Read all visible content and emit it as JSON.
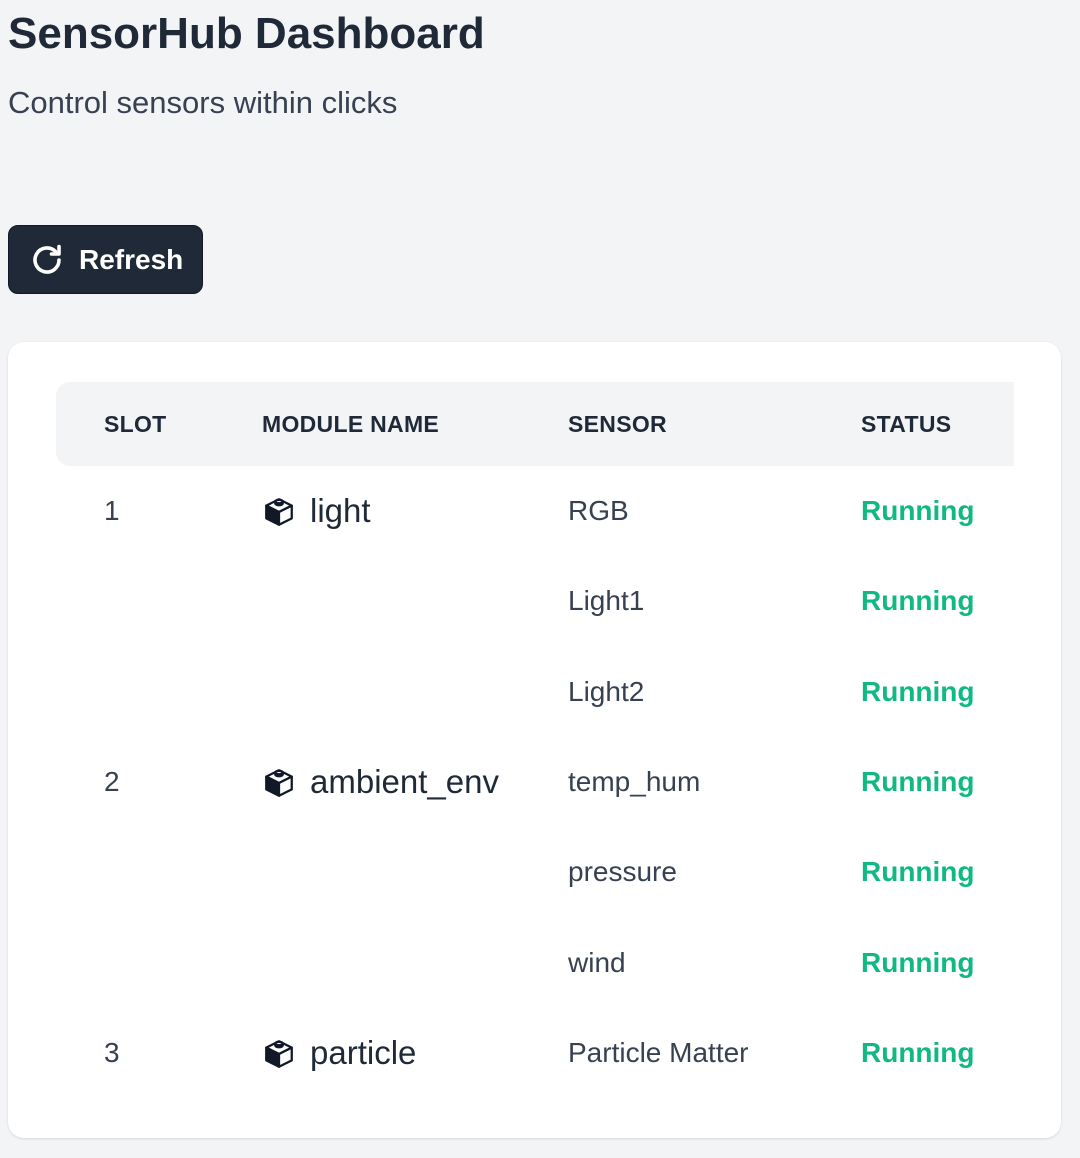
{
  "header": {
    "title": "SensorHub Dashboard",
    "subtitle": "Control sensors within clicks"
  },
  "toolbar": {
    "refresh_label": "Refresh",
    "refresh_icon": "refresh-icon"
  },
  "table": {
    "columns": [
      "SLOT",
      "MODULE NAME",
      "SENSOR",
      "STATUS"
    ],
    "module_icon": "cube-icon",
    "status_color": "#10b981",
    "rows": [
      {
        "slot": "1",
        "module": "light",
        "sensor": "RGB",
        "status": "Running"
      },
      {
        "slot": "",
        "module": "",
        "sensor": "Light1",
        "status": "Running"
      },
      {
        "slot": "",
        "module": "",
        "sensor": "Light2",
        "status": "Running"
      },
      {
        "slot": "2",
        "module": "ambient_env",
        "sensor": "temp_hum",
        "status": "Running"
      },
      {
        "slot": "",
        "module": "",
        "sensor": "pressure",
        "status": "Running"
      },
      {
        "slot": "",
        "module": "",
        "sensor": "wind",
        "status": "Running"
      },
      {
        "slot": "3",
        "module": "particle",
        "sensor": "Particle Matter",
        "status": "Running"
      }
    ]
  }
}
